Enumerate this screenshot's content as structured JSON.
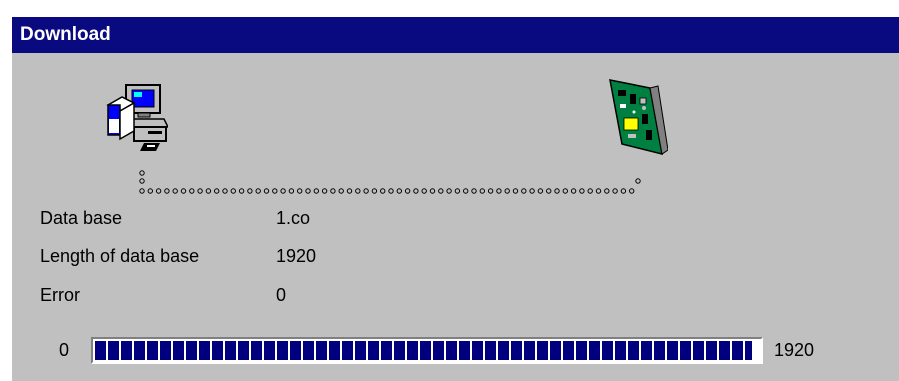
{
  "window": {
    "title": "Download"
  },
  "icons": {
    "source": "computer-install-icon",
    "target": "circuit-board-icon"
  },
  "fields": [
    {
      "label": "Data base",
      "value": "1.co"
    },
    {
      "label": "Length of data base",
      "value": "1920"
    },
    {
      "label": "Error",
      "value": "0"
    }
  ],
  "progress": {
    "min": "0",
    "max": "1920",
    "fraction": 0.99
  },
  "colors": {
    "titlebar": "#0a0a80",
    "dialog": "#c0c0c0",
    "progress_block": "#00007f"
  }
}
